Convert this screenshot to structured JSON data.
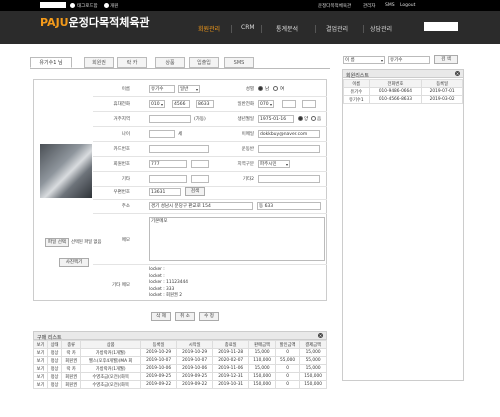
{
  "topbar": {
    "checkbox_label": "태그로드함",
    "radio_label": "개원",
    "right_links": [
      "운정다목적체육관",
      "관리자",
      "SMS",
      "Logout"
    ]
  },
  "nav": {
    "logo_main": "운정다목적체육관",
    "logo_accent": "PAJU",
    "items": [
      "회원관리",
      "CRM",
      "통계분석",
      "결업관리",
      "상담관리"
    ]
  },
  "tabs": [
    "유기수1 님",
    "회원권",
    "락 카",
    "상품",
    "입출입",
    "SMS"
  ],
  "form": {
    "name_label": "이름",
    "name_value": "유기수",
    "name_select": "일반",
    "gender_label": "성별",
    "gender_male": "남",
    "gender_female": "여",
    "phone_label": "휴대전화",
    "phone1": "010",
    "phone2": "4566",
    "phone3": "8633",
    "home_phone_label": "일반전화",
    "home1": "070",
    "home2": "",
    "home3": "",
    "sms_label": "거주지역",
    "sms_note": "(가동)",
    "birth_label": "생년월일",
    "birth_value": "1975-01-16",
    "calendar_solar": "양",
    "calendar_lunar": "음",
    "age_label": "나이",
    "age_value": "",
    "age_unit": "세",
    "email_label": "이메일",
    "email_value": "dokkbuy@naver.com",
    "card_label": "카드번호",
    "card_value": "",
    "stamp_label": "운동반",
    "stamp_value": "",
    "member_label": "회원번호",
    "member_value": "777",
    "region_label": "지역구분",
    "region_value": "파주시민",
    "etc_label": "기타",
    "etc_value": "",
    "etc2_label": "기타2",
    "etc2_value": "",
    "zip_label": "우편번호",
    "zip_value": "13631",
    "zip_button": "검색",
    "addr_label": "주소",
    "addr1": "경기 성남시 분당구 판교로 154",
    "addr2": "동 633",
    "memo_label": "메모",
    "memo_value": "기본메모",
    "file_button": "파일 선택",
    "file_status": "선택된 파일 없음",
    "photo_button": "사진찍기",
    "history_label": "기타 메모",
    "history_lines": [
      "locker :",
      "locket :",
      "locker : 11123444",
      "locket : 333",
      "locket : 회원권 2"
    ],
    "buttons": [
      "삭 제",
      "취 소",
      "수 정"
    ]
  },
  "purchases": {
    "title": "구매 리스트",
    "headers": [
      "보기",
      "상태",
      "종류",
      "상품",
      "등록일",
      "시작일",
      "종료일",
      "판매금액",
      "할인금액",
      "결제금액"
    ],
    "rows": [
      [
        "보기",
        "정상",
        "락 카",
        "가방락커(1개월)",
        "2019-10-29",
        "2019-10-29",
        "2019-11-28",
        "15,000",
        "0",
        "15,000"
      ],
      [
        "보기",
        "정상",
        "회원권",
        "헬스(오후4개월)(MA 회",
        "2019-10-07",
        "2019-10-07",
        "2020-02-07",
        "110,000",
        "55,000",
        "55,000"
      ],
      [
        "보기",
        "정상",
        "락 카",
        "가방락커(1개월)",
        "2019-10-06",
        "2019-10-06",
        "2019-11-06",
        "15,000",
        "0",
        "15,000"
      ],
      [
        "보기",
        "정상",
        "회원권",
        "수영초급(오전)(화목",
        "2019-09-25",
        "2019-09-25",
        "2019-12-31",
        "150,000",
        "0",
        "150,000"
      ],
      [
        "보기",
        "정상",
        "회원권",
        "수영초급(오전)(화목",
        "2019-09-22",
        "2019-09-22",
        "2019-10-31",
        "150,000",
        "0",
        "150,000"
      ]
    ]
  },
  "right": {
    "search_select": "이 름",
    "search_value": "유기수",
    "search_button": "검 색",
    "list_title": "회원리스트",
    "headers": [
      "이름",
      "전화번호",
      "등록일"
    ],
    "rows": [
      [
        "유기수",
        "010-9486-0664",
        "2019-07-01"
      ],
      [
        "유기수1",
        "010-4566-8633",
        "2019-03-02"
      ]
    ]
  }
}
